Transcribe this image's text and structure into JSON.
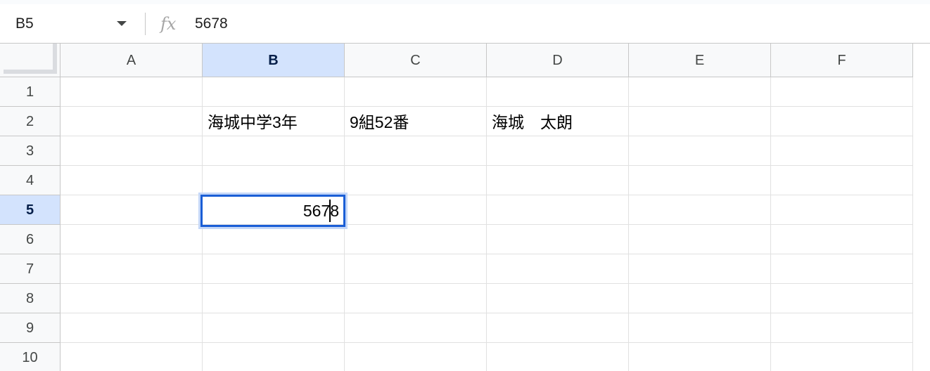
{
  "formula_bar": {
    "name_box": "B5",
    "fx_label": "fx",
    "formula": "5678"
  },
  "columns": [
    "A",
    "B",
    "C",
    "D",
    "E",
    "F"
  ],
  "rows": [
    "1",
    "2",
    "3",
    "4",
    "5",
    "6",
    "7",
    "8",
    "9",
    "10"
  ],
  "cells": {
    "B2": "海城中学3年",
    "C2": "9組52番",
    "D2": "海城　太朗",
    "B5": "5678"
  },
  "selection": {
    "active_cell": "B5",
    "selected_column": "B",
    "selected_row": "5"
  },
  "colors": {
    "selection_border": "#1a5ed6",
    "header_highlight": "#d3e3fd",
    "gridline": "#e1e1e1"
  }
}
